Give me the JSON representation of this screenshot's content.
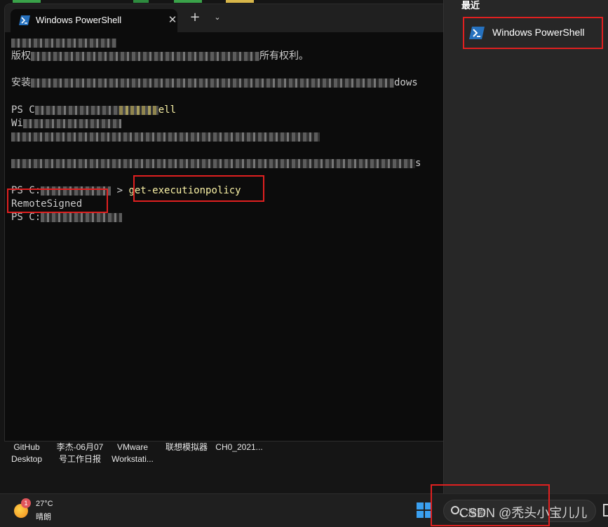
{
  "terminal": {
    "tab_title": "Windows PowerShell",
    "close_symbol": "✕",
    "new_tab_symbol": "+",
    "dropdown_symbol": "⌄",
    "console": {
      "copyright_prefix": "版权",
      "copyright_suffix": "所有权利。",
      "install_prefix": "安装",
      "install_suffix": "dows",
      "prompt1_prefix": "PS C",
      "prompt1_suffix": "ell",
      "line_w": "Wi",
      "line_s": "s",
      "prompt2_prefix": "PS C:",
      "prompt2_sep": " > ",
      "command": "get-executionpolicy",
      "result": "RemoteSigned",
      "prompt3": "PS C:"
    }
  },
  "dock": {
    "items": [
      {
        "line1": "GitHub",
        "line2": "Desktop"
      },
      {
        "line1": "李杰-06月07",
        "line2": "号工作日报"
      },
      {
        "line1": "VMware",
        "line2": "Workstati..."
      },
      {
        "line1": "联想模拟器",
        "line2": ""
      },
      {
        "line1": "CH0_2021...",
        "line2": ""
      }
    ]
  },
  "taskbar": {
    "weather_badge": "1",
    "temperature": "27°C",
    "condition": "晴朗",
    "search_placeholder": "搜索"
  },
  "watermark": "CSDN @秃头小宝儿儿",
  "panel": {
    "heading": "最近",
    "recent_label": "Windows PowerShell"
  },
  "colors": {
    "terminal_bg": "#0c0c0c",
    "command_color": "#f9f1a5",
    "highlight_box": "#e02020",
    "accent_blue": "#3aa0f0"
  }
}
